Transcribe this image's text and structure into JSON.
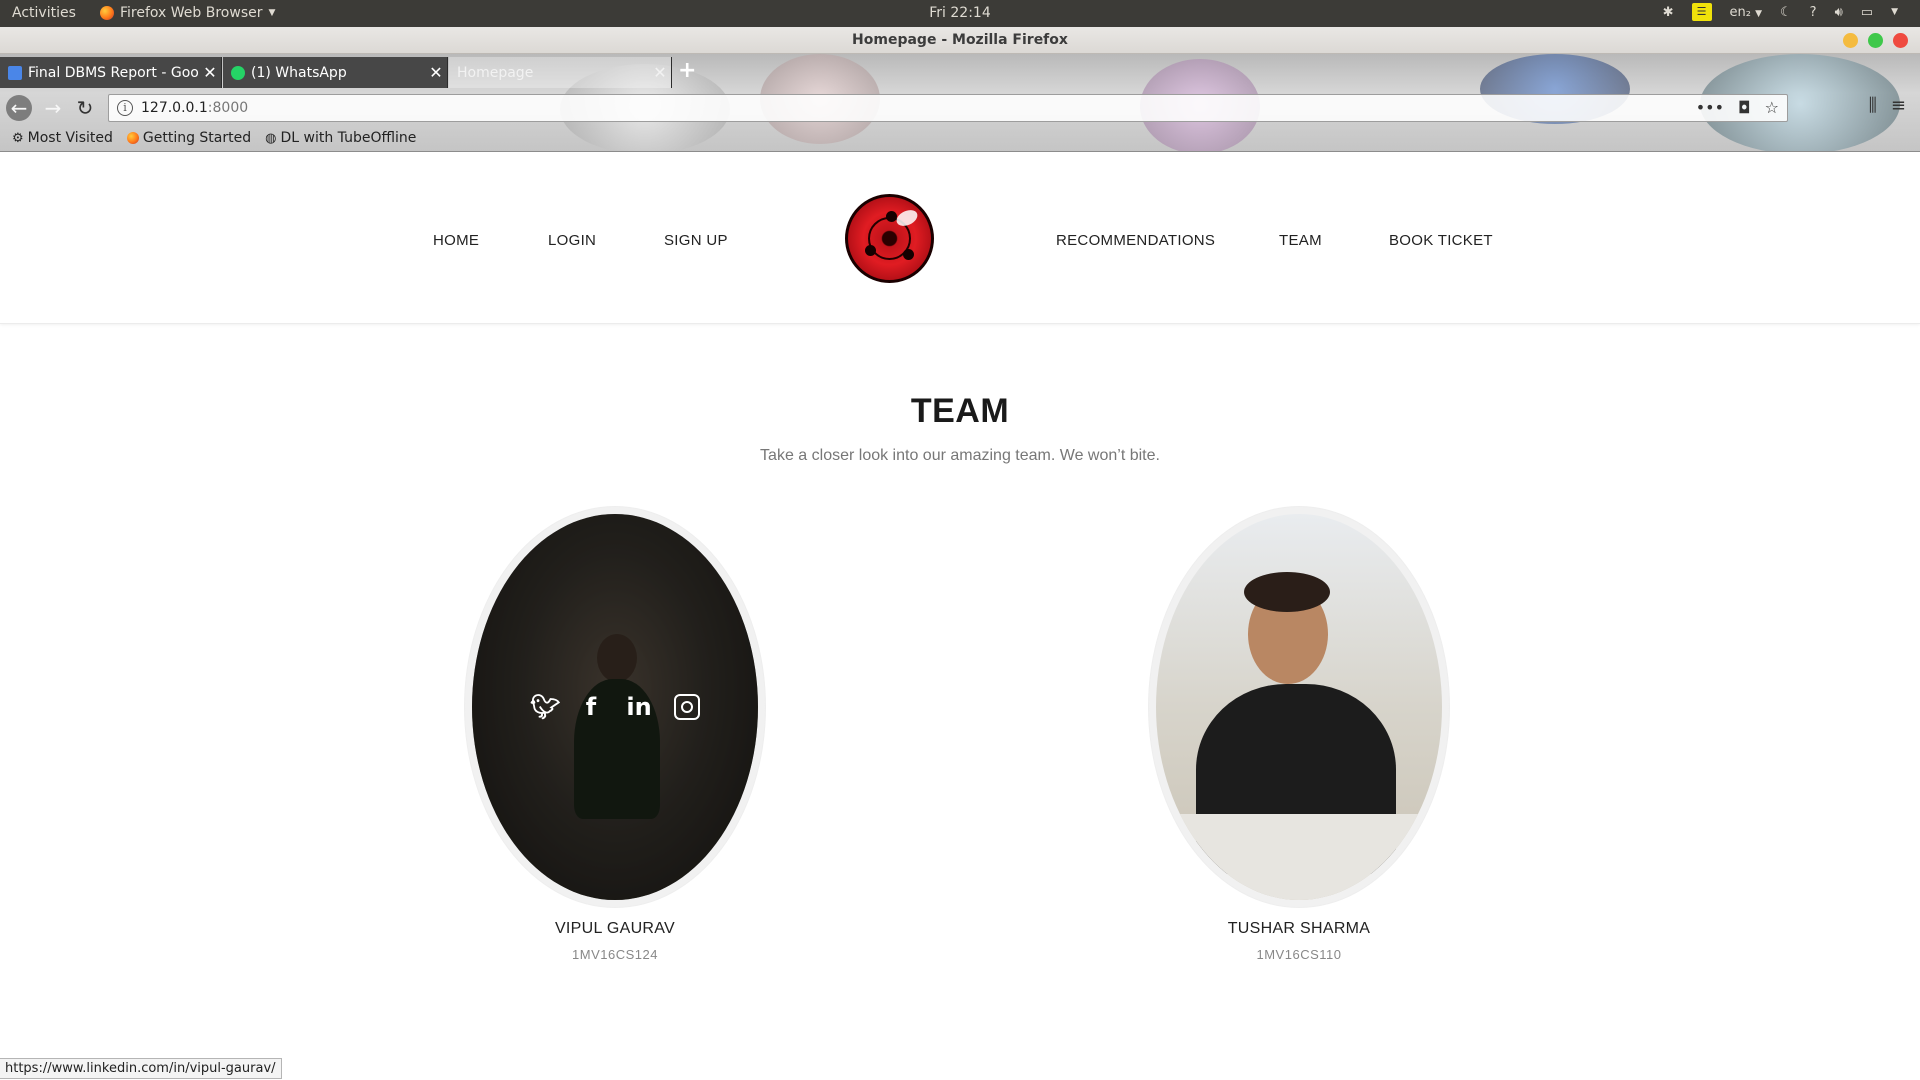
{
  "system": {
    "activities": "Activities",
    "app_menu": "Firefox Web Browser",
    "clock": "Fri 22:14",
    "language": "en₂"
  },
  "window": {
    "title": "Homepage - Mozilla Firefox"
  },
  "tabs": [
    {
      "title": "Final DBMS Report - Goo",
      "icon": "docs-icon",
      "color": "#4a86e8"
    },
    {
      "title": "(1) WhatsApp",
      "icon": "whatsapp-icon",
      "color": "#25d366"
    },
    {
      "title": "Homepage",
      "icon": "",
      "color": ""
    }
  ],
  "address_bar": {
    "host": "127.0.0.1",
    "port": ":8000"
  },
  "bookmarks": [
    {
      "label": "Most Visited",
      "icon": "gear-icon"
    },
    {
      "label": "Getting Started",
      "icon": "firefox-icon"
    },
    {
      "label": "DL with TubeOffline",
      "icon": "globe-icon"
    }
  ],
  "site_nav": {
    "left": [
      "HOME",
      "LOGIN",
      "SIGN UP"
    ],
    "right": [
      "RECOMMENDATIONS",
      "TEAM",
      "BOOK TICKET"
    ]
  },
  "team": {
    "title": "TEAM",
    "subtitle": "Take a closer look into our amazing team. We won’t bite.",
    "members": [
      {
        "name": "VIPUL GAURAV",
        "id": "1MV16CS124",
        "hovered": true
      },
      {
        "name": "TUSHAR SHARMA",
        "id": "1MV16CS110",
        "hovered": false
      }
    ],
    "social_icons": [
      "twitter-icon",
      "facebook-icon",
      "linkedin-icon",
      "instagram-icon"
    ]
  },
  "status_url": "https://www.linkedin.com/in/vipul-gaurav/"
}
